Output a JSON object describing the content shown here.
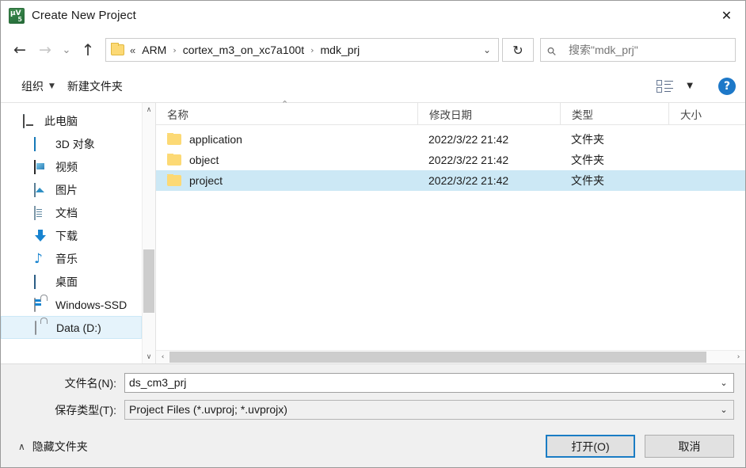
{
  "window": {
    "title": "Create New Project",
    "app_icon": "keil-uvision-icon",
    "close_label": "✕"
  },
  "nav": {
    "back": "←",
    "forward": "→",
    "recent": "⌄",
    "up": "↑",
    "refresh": "↻",
    "dropdown": "⌄"
  },
  "address": {
    "lead": "«",
    "crumbs": [
      "ARM",
      "cortex_m3_on_xc7a100t",
      "mdk_prj"
    ],
    "separator": "›"
  },
  "search": {
    "icon": "search-icon",
    "placeholder": "搜索\"mdk_prj\""
  },
  "command_bar": {
    "organize": "组织",
    "organize_caret": "▼",
    "new_folder": "新建文件夹",
    "view_caret": "▼",
    "help": "?"
  },
  "sidebar": {
    "items": [
      {
        "label": "此电脑",
        "icon": "pc-icon",
        "level": 0
      },
      {
        "label": "3D 对象",
        "icon": "3d-objects-icon",
        "level": 1
      },
      {
        "label": "视频",
        "icon": "videos-icon",
        "level": 1
      },
      {
        "label": "图片",
        "icon": "pictures-icon",
        "level": 1
      },
      {
        "label": "文档",
        "icon": "documents-icon",
        "level": 1
      },
      {
        "label": "下载",
        "icon": "downloads-icon",
        "level": 1
      },
      {
        "label": "音乐",
        "icon": "music-icon",
        "level": 1
      },
      {
        "label": "桌面",
        "icon": "desktop-icon",
        "level": 1
      },
      {
        "label": "Windows-SSD",
        "icon": "drive-system-icon",
        "level": 1
      },
      {
        "label": "Data (D:)",
        "icon": "drive-icon",
        "level": 1,
        "selected": true
      }
    ],
    "scroll_up": "∧",
    "scroll_down": "∨"
  },
  "file_list": {
    "columns": [
      "名称",
      "修改日期",
      "类型",
      "大小"
    ],
    "sort_caret": "⌃",
    "rows": [
      {
        "name": "application",
        "date": "2022/3/22 21:42",
        "type": "文件夹",
        "size": "",
        "selected": false
      },
      {
        "name": "object",
        "date": "2022/3/22 21:42",
        "type": "文件夹",
        "size": "",
        "selected": false
      },
      {
        "name": "project",
        "date": "2022/3/22 21:42",
        "type": "文件夹",
        "size": "",
        "selected": true
      }
    ],
    "scroll_left": "‹",
    "scroll_right": "›"
  },
  "form": {
    "filename_label": "文件名(N):",
    "filename_value": "ds_cm3_prj",
    "filetype_label": "保存类型(T):",
    "filetype_value": "Project Files (*.uvproj; *.uvprojx)",
    "dropdown_caret": "⌄"
  },
  "actions": {
    "hide_folders_caret": "∧",
    "hide_folders_label": "隐藏文件夹",
    "open_label": "打开(O)",
    "cancel_label": "取消"
  },
  "colors": {
    "selection": "#cce8f5",
    "accent": "#1a7cc4",
    "folder": "#fcd975",
    "window_bg": "#f0f0f0"
  }
}
